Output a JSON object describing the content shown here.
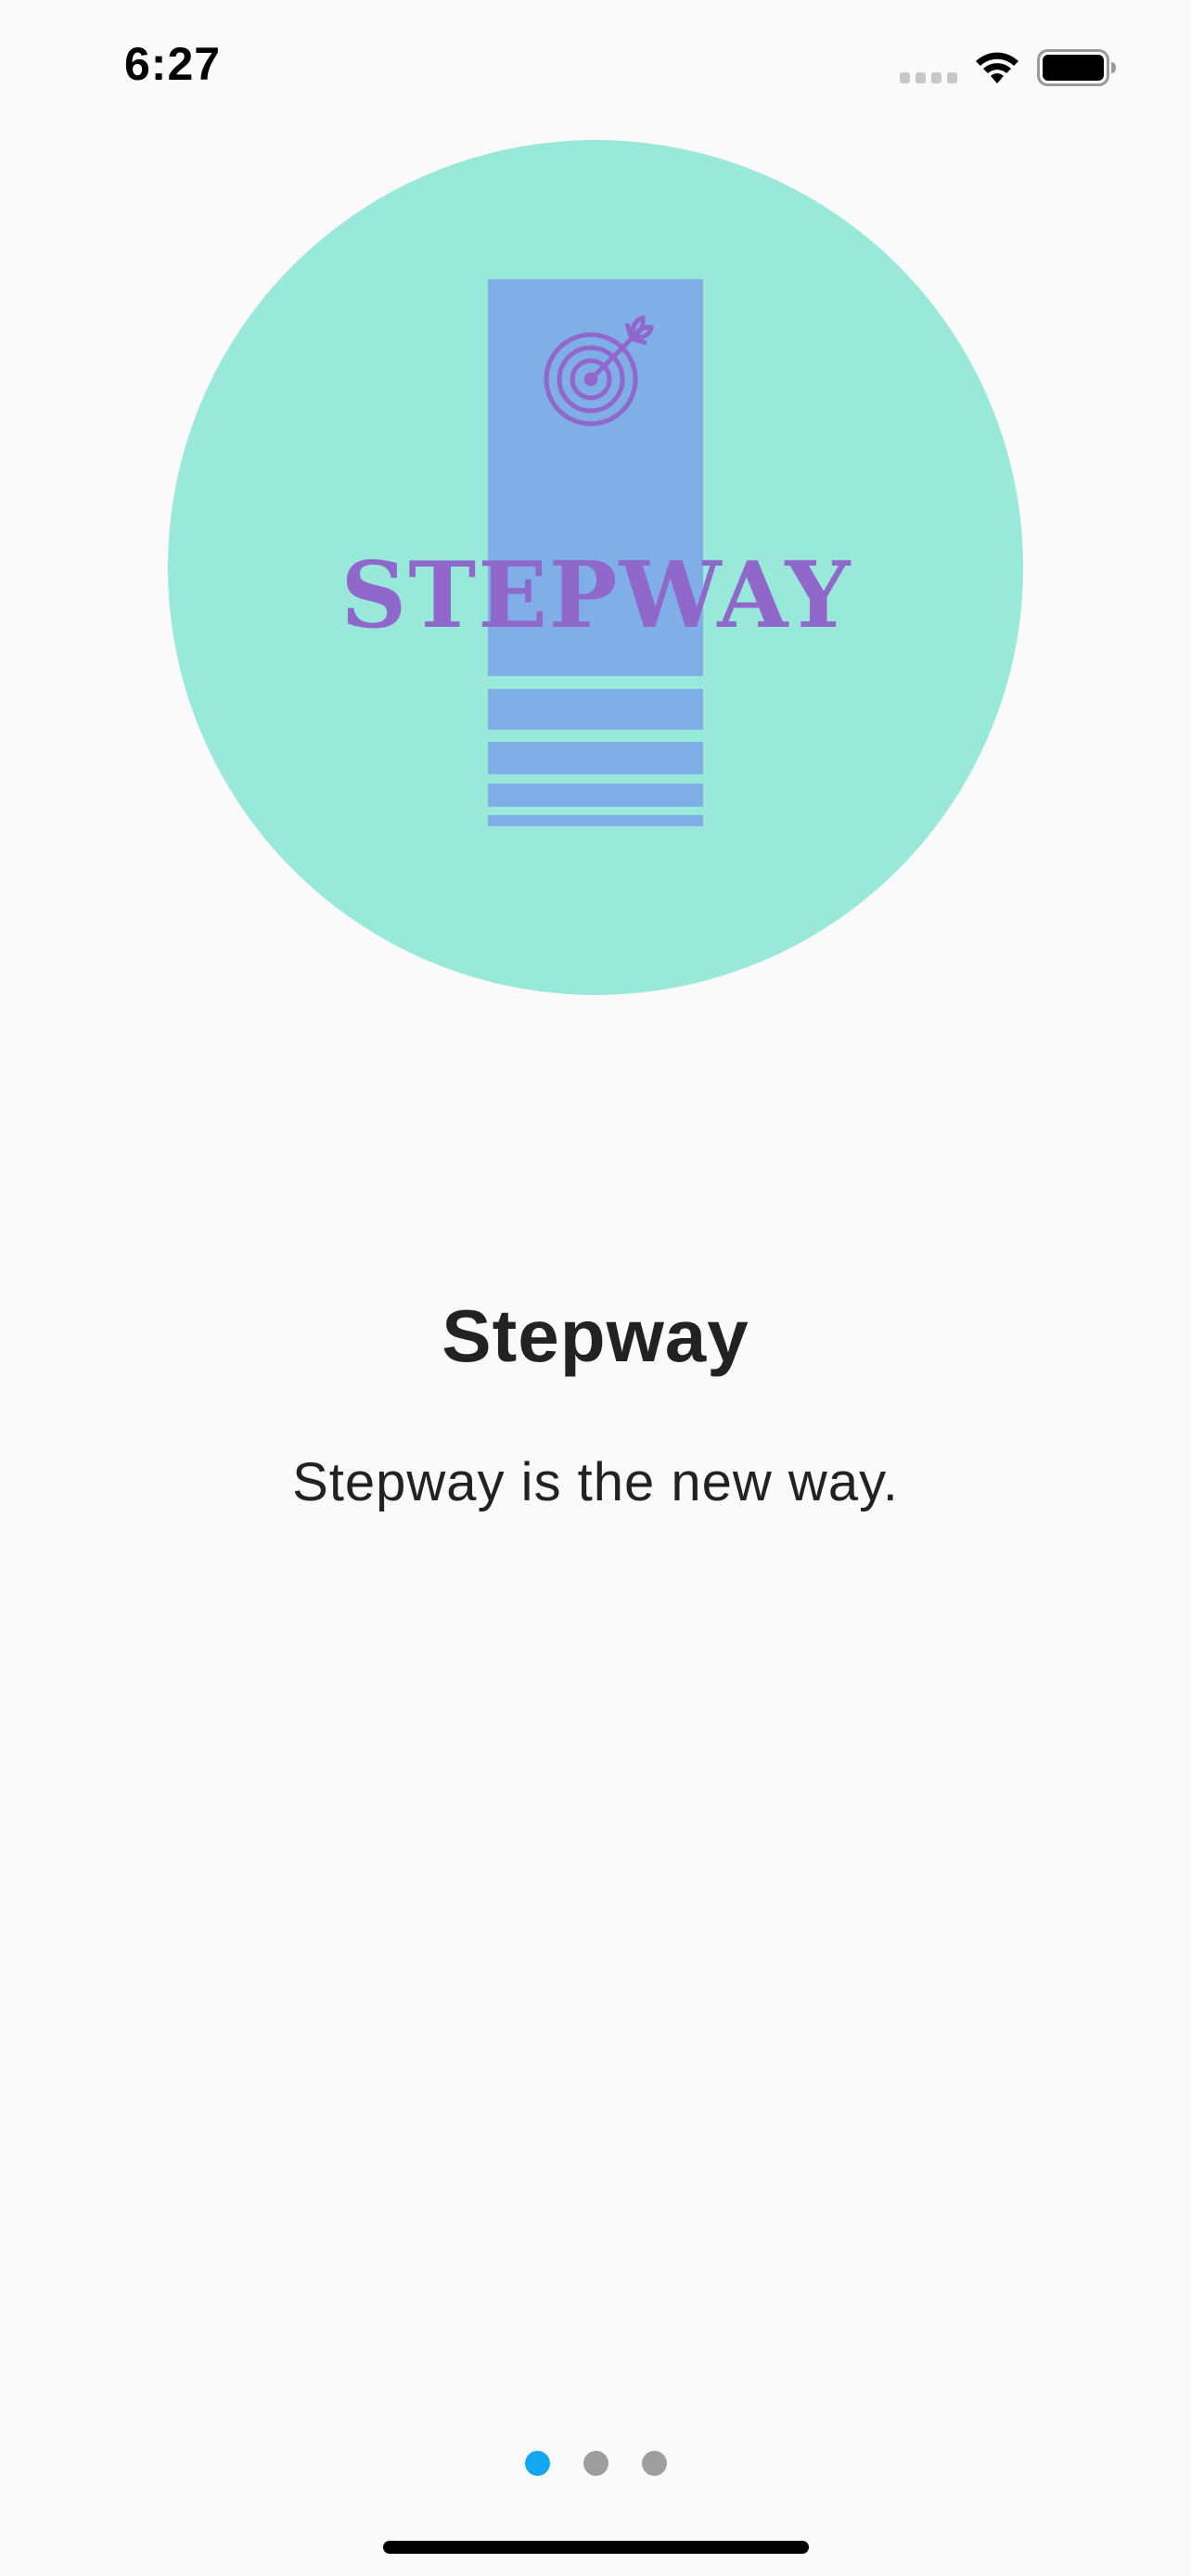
{
  "status_bar": {
    "time": "6:27",
    "signal_icon": "cellular-signal-icon",
    "wifi_icon": "wifi-icon",
    "battery_icon": "battery-icon"
  },
  "logo": {
    "wordmark": "STEPWAY",
    "icon": "target-arrow-icon",
    "colors": {
      "circle": "#98e9d9",
      "panel": "#80aee6",
      "mark": "#9068cc"
    }
  },
  "onboarding": {
    "title": "Stepway",
    "subtitle": "Stepway is the new way."
  },
  "pagination": {
    "total": 3,
    "active_index": 0,
    "active_color": "#13a7ef",
    "inactive_color": "#9e9e9e"
  }
}
